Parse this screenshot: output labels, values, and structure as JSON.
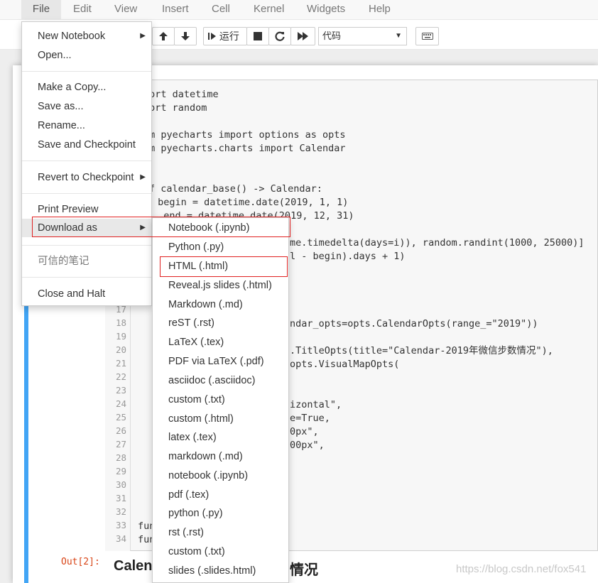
{
  "menubar": {
    "items": [
      "File",
      "Edit",
      "View",
      "Insert",
      "Cell",
      "Kernel",
      "Widgets",
      "Help"
    ]
  },
  "toolbar": {
    "run_label": "运行",
    "cell_type": "代码",
    "icons": [
      "arrow-up-icon",
      "arrow-down-icon",
      "run-icon",
      "stop-icon",
      "restart-icon",
      "fast-forward-icon",
      "keyboard-icon"
    ]
  },
  "file_menu": {
    "items": [
      {
        "label": "New Notebook",
        "submenu": true
      },
      {
        "label": "Open..."
      },
      {
        "label": "Make a Copy..."
      },
      {
        "label": "Save as..."
      },
      {
        "label": "Rename..."
      },
      {
        "label": "Save and Checkpoint"
      },
      {
        "label": "Revert to Checkpoint",
        "submenu": true
      },
      {
        "label": "Print Preview"
      },
      {
        "label": "Download as",
        "submenu": true
      },
      {
        "label": "可信的笔记",
        "disabled": true
      },
      {
        "label": "Close and Halt"
      }
    ]
  },
  "download_menu": {
    "items": [
      "Notebook (.ipynb)",
      "Python (.py)",
      "HTML (.html)",
      "Reveal.js slides (.html)",
      "Markdown (.md)",
      "reST (.rst)",
      "LaTeX (.tex)",
      "PDF via LaTeX (.pdf)",
      "asciidoc (.asciidoc)",
      "custom (.txt)",
      "custom (.html)",
      "latex (.tex)",
      "markdown (.md)",
      "notebook (.ipynb)",
      "pdf (.tex)",
      "python (.py)",
      "rst (.rst)",
      "custom (.txt)",
      "slides (.slides.html)"
    ]
  },
  "code": {
    "line_numbers": [
      "17",
      "18",
      "19",
      "20",
      "21",
      "22",
      "23",
      "24",
      "25",
      "26",
      "27",
      "28",
      "29",
      "30",
      "31",
      "32",
      "33",
      "34"
    ],
    "lines": {
      "l1": "port datetime",
      "l2": "port random",
      "l3": "om pyecharts import options as opts",
      "l4": "om pyecharts.charts import Calendar",
      "l5": "f calendar_base() -> Calendar:",
      "l6": " begin = datetime.date(2019, 1, 1)",
      "l7": "  end = datetime.date(2019, 12, 31)",
      "l8": "me.timedelta(days=i)), random.randint(1000, 25000)]",
      "l9": "l - begin).days + 1)",
      "l10": "ndar_opts=opts.CalendarOpts(range_=\"2019\"))",
      "l11": ".TitleOpts(title=\"Calendar-2019年微信步数情况\"),",
      "l12": "opts.VisualMapOpts(",
      "l13": "izontal\",",
      "l14": "e=True,",
      "l15": "0px\",",
      "l16": "00px\",",
      "l17": "fun",
      "l18": "fun"
    }
  },
  "output": {
    "prompt": "Out[2]:",
    "title": "Calen",
    "title_tail": "情况"
  },
  "watermark": "https://blog.csdn.net/fox541"
}
